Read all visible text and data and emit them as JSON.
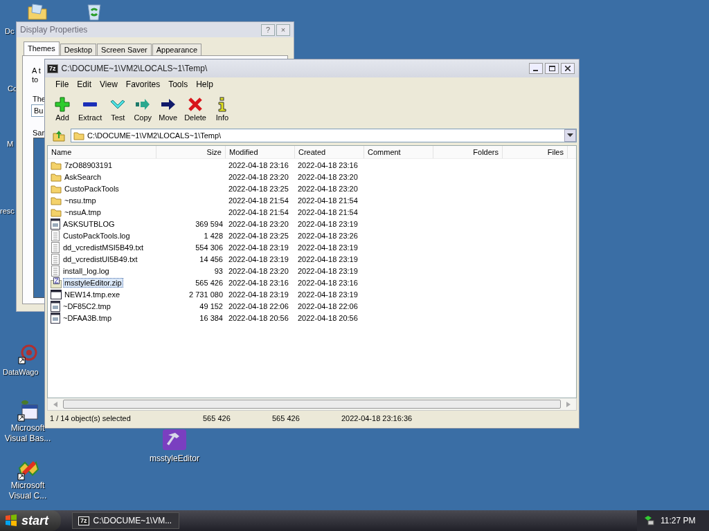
{
  "desktop_icons": [
    {
      "kind": "folder",
      "label": "Dc"
    },
    {
      "kind": "recycle"
    },
    {
      "kind": "hidden",
      "label": "Cc"
    },
    {
      "kind": "hidden",
      "label": "M"
    },
    {
      "kind": "hidden",
      "label": "resc"
    },
    {
      "kind": "wagon",
      "label": "DataWago"
    },
    {
      "kind": "vb",
      "label": "Microsoft Visual Bas..."
    },
    {
      "kind": "vc",
      "label": "Microsoft Visual C..."
    },
    {
      "kind": "hammer",
      "label": "msstyleEditor"
    }
  ],
  "display_properties": {
    "title": "Display Properties",
    "buttons": [
      "?",
      "×"
    ],
    "tabs": [
      {
        "label": "Themes",
        "selected": true
      },
      {
        "label": "Desktop",
        "selected": false
      },
      {
        "label": "Screen Saver",
        "selected": false
      },
      {
        "label": "Appearance",
        "selected": false
      }
    ],
    "fragments": [
      {
        "kind": "text",
        "text": "A t"
      },
      {
        "kind": "text",
        "text": "to"
      },
      {
        "kind": "text",
        "text": "The"
      },
      {
        "kind": "field",
        "text": "Bu"
      },
      {
        "kind": "text",
        "text": "Sar"
      },
      {
        "kind": "preview"
      }
    ]
  },
  "archiver": {
    "title": "C:\\DOCUME~1\\VM2\\LOCALS~1\\Temp\\",
    "app_badge": "7z",
    "menu": [
      "File",
      "Edit",
      "View",
      "Favorites",
      "Tools",
      "Help"
    ],
    "toolbar": [
      {
        "label": "Add",
        "kind": "add"
      },
      {
        "label": "Extract",
        "kind": "extract"
      },
      {
        "label": "Test",
        "kind": "test"
      },
      {
        "label": "Copy",
        "kind": "copy"
      },
      {
        "label": "Move",
        "kind": "move"
      },
      {
        "label": "Delete",
        "kind": "delete"
      },
      {
        "label": "Info",
        "kind": "info"
      }
    ],
    "address": "C:\\DOCUME~1\\VM2\\LOCALS~1\\Temp\\",
    "columns": [
      "Name",
      "Size",
      "Modified",
      "Created",
      "Comment",
      "Folders",
      "Files"
    ],
    "rows": [
      {
        "name": "7zO88903191",
        "size": "",
        "modified": "2022-04-18 23:16",
        "created": "2022-04-18 23:16",
        "kind": "folder",
        "selected": false
      },
      {
        "name": "AskSearch",
        "size": "",
        "modified": "2022-04-18 23:20",
        "created": "2022-04-18 23:20",
        "kind": "folder",
        "selected": false
      },
      {
        "name": "CustoPackTools",
        "size": "",
        "modified": "2022-04-18 23:25",
        "created": "2022-04-18 23:20",
        "kind": "folder",
        "selected": false
      },
      {
        "name": "~nsu.tmp",
        "size": "",
        "modified": "2022-04-18 21:54",
        "created": "2022-04-18 21:54",
        "kind": "folder",
        "selected": false
      },
      {
        "name": "~nsuA.tmp",
        "size": "",
        "modified": "2022-04-18 21:54",
        "created": "2022-04-18 21:54",
        "kind": "folder",
        "selected": false
      },
      {
        "name": "ASKSUTBLOG",
        "size": "369 594",
        "modified": "2022-04-18 23:20",
        "created": "2022-04-18 23:19",
        "kind": "app",
        "selected": false
      },
      {
        "name": "CustoPackTools.log",
        "size": "1 428",
        "modified": "2022-04-18 23:25",
        "created": "2022-04-18 23:26",
        "kind": "text",
        "selected": false
      },
      {
        "name": "dd_vcredistMSI5B49.txt",
        "size": "554 306",
        "modified": "2022-04-18 23:19",
        "created": "2022-04-18 23:19",
        "kind": "text",
        "selected": false
      },
      {
        "name": "dd_vcredistUI5B49.txt",
        "size": "14 456",
        "modified": "2022-04-18 23:19",
        "created": "2022-04-18 23:19",
        "kind": "text",
        "selected": false
      },
      {
        "name": "install_log.log",
        "size": "93",
        "modified": "2022-04-18 23:20",
        "created": "2022-04-18 23:19",
        "kind": "text",
        "selected": false
      },
      {
        "name": "msstyleEditor.zip",
        "size": "565 426",
        "modified": "2022-04-18 23:16",
        "created": "2022-04-18 23:16",
        "kind": "zip",
        "selected": true
      },
      {
        "name": "NEW14.tmp.exe",
        "size": "2 731 080",
        "modified": "2022-04-18 23:19",
        "created": "2022-04-18 23:19",
        "kind": "exe",
        "selected": false
      },
      {
        "name": "~DF85C2.tmp",
        "size": "49 152",
        "modified": "2022-04-18 22:06",
        "created": "2022-04-18 22:06",
        "kind": "app",
        "selected": false
      },
      {
        "name": "~DFAA3B.tmp",
        "size": "16 384",
        "modified": "2022-04-18 20:56",
        "created": "2022-04-18 20:56",
        "kind": "app",
        "selected": false
      }
    ],
    "status": [
      "1 / 14 object(s) selected",
      "565 426",
      "565 426",
      "2022-04-18 23:16:36"
    ]
  },
  "taskbar": {
    "start": "start",
    "tasks": [
      {
        "label": "C:\\DOCUME~1\\VM...",
        "badge": "7z"
      }
    ],
    "clock": "11:27 PM"
  }
}
